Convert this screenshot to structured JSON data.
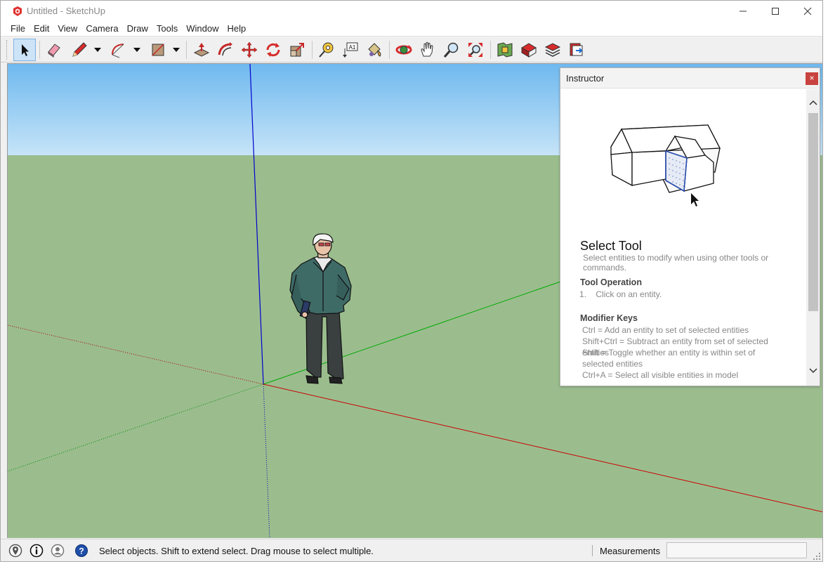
{
  "window": {
    "title": "Untitled - SketchUp",
    "controls": [
      "minimize",
      "maximize",
      "close"
    ]
  },
  "menu": [
    "File",
    "Edit",
    "View",
    "Camera",
    "Draw",
    "Tools",
    "Window",
    "Help"
  ],
  "toolbar": {
    "tools": [
      {
        "name": "select-tool",
        "icon": "arrow-cursor-icon",
        "active": true
      },
      {
        "name": "eraser-tool",
        "icon": "eraser-icon"
      },
      {
        "name": "line-tool",
        "icon": "pencil-icon",
        "has_dropdown": true
      },
      {
        "name": "arc-tool",
        "icon": "arc-icon",
        "has_dropdown": true
      },
      {
        "name": "rectangle-tool",
        "icon": "rectangle-icon",
        "has_dropdown": true
      },
      {
        "name": "push-pull-tool",
        "icon": "push-pull-icon"
      },
      {
        "name": "offset-tool",
        "icon": "offset-icon"
      },
      {
        "name": "move-tool",
        "icon": "move-icon"
      },
      {
        "name": "rotate-tool",
        "icon": "rotate-icon"
      },
      {
        "name": "scale-tool",
        "icon": "scale-icon"
      },
      {
        "name": "tape-measure-tool",
        "icon": "tape-measure-icon"
      },
      {
        "name": "text-tool",
        "icon": "text-icon"
      },
      {
        "name": "paint-bucket-tool",
        "icon": "paint-bucket-icon"
      },
      {
        "name": "orbit-tool",
        "icon": "orbit-icon"
      },
      {
        "name": "pan-tool",
        "icon": "pan-hand-icon"
      },
      {
        "name": "zoom-tool",
        "icon": "zoom-icon"
      },
      {
        "name": "zoom-extents-tool",
        "icon": "zoom-extents-icon"
      },
      {
        "name": "warehouse-button",
        "icon": "3d-warehouse-icon"
      },
      {
        "name": "extension-warehouse-button",
        "icon": "extension-warehouse-icon"
      },
      {
        "name": "extension-manager-button",
        "icon": "extension-manager-icon"
      },
      {
        "name": "send-to-layout-button",
        "icon": "layout-icon"
      }
    ]
  },
  "text_tool_label": "A1",
  "instructor": {
    "title": "Instructor",
    "close_label": "×",
    "tool_name": "Select Tool",
    "tool_description": "Select entities to modify when using other tools or commands.",
    "operation_heading": "Tool Operation",
    "operation_steps": [
      {
        "num": "1.",
        "text": "Click on an entity."
      }
    ],
    "modifier_heading": "Modifier Keys",
    "modifier_lines": [
      "Ctrl = Add an entity to set of selected entities",
      "Shift+Ctrl = Subtract an entity from set of selected entities",
      "Shift = Toggle whether an entity is within set of selected entities",
      "Ctrl+A = Select all visible entities in model"
    ]
  },
  "statusbar": {
    "message": "Select objects. Shift to extend select. Drag mouse to select multiple.",
    "measurements_label": "Measurements",
    "measurements_value": ""
  },
  "colors": {
    "sky_top": "#6fb9ef",
    "ground": "#9bbd8e",
    "axis_red": "#cc0000",
    "axis_green": "#009900",
    "axis_blue": "#0000cc",
    "accent_active": "#cde4f7",
    "close_red": "#c8433f"
  }
}
